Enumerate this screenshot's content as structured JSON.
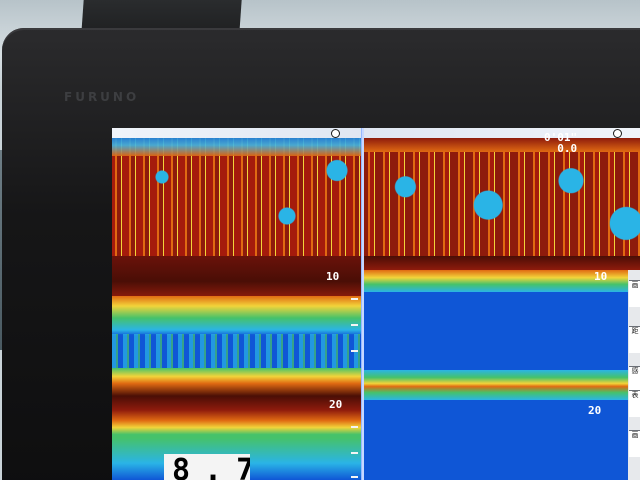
{
  "device": {
    "brand": "FURUNO"
  },
  "range_readout": {
    "line1": "0'01\"",
    "line2": "0.0"
  },
  "left_pane": {
    "depth_labels": [
      "10",
      "20"
    ]
  },
  "right_pane": {
    "depth_labels": [
      "10",
      "20"
    ]
  },
  "depth_readout": {
    "value": "8.7"
  },
  "side_panel": {
    "buttons": [
      "画",
      "距",
      "感",
      "表",
      "画"
    ]
  },
  "colors": {
    "background_blue": "#0f56d6",
    "strong_echo_red": "#8e1b0c",
    "echo_orange": "#e06a12",
    "echo_yellow": "#f2d43a",
    "echo_green": "#46c26a",
    "echo_cyan": "#2ab4e6",
    "bottom_dark_red": "#4a0e06",
    "divider": "#dfe8ff"
  }
}
